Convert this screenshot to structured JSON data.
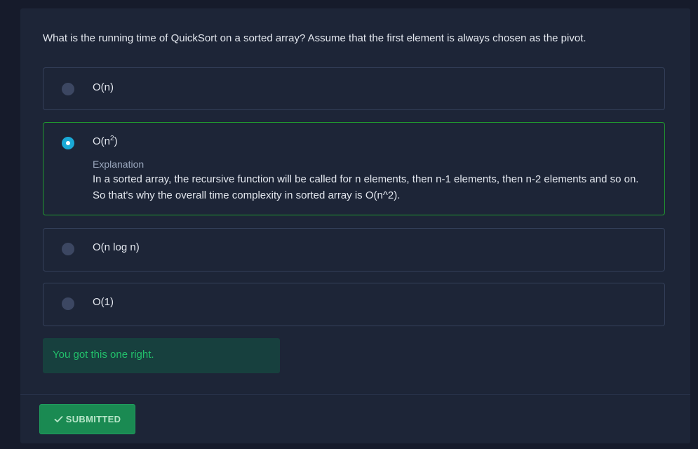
{
  "question": {
    "text": "What is the running time of QuickSort on a sorted array? Assume that the first element is always chosen as the pivot."
  },
  "options": [
    {
      "label": "O(n)",
      "selected": false
    },
    {
      "label_base": "O(n",
      "label_sup": "2",
      "label_tail": ")",
      "selected": true
    },
    {
      "label": "O(n log n)",
      "selected": false
    },
    {
      "label": "O(1)",
      "selected": false
    }
  ],
  "explanation": {
    "title": "Explanation",
    "text": "In a sorted array, the recursive function will be called for n elements, then n-1 elements, then n-2 elements and so on. So that's why the overall time complexity in sorted array is O(n^2)."
  },
  "feedback": {
    "text": "You got this one right."
  },
  "submit": {
    "label": "SUBMITTED",
    "icon": "check-icon"
  },
  "colors": {
    "page_bg": "#161b2b",
    "card_bg": "#1d2537",
    "option_border": "#34405a",
    "selected_border": "#20982f",
    "radio_checked": "#1aa9d6",
    "feedback_bg": "#17403e",
    "feedback_text": "#22c16b",
    "submit_bg": "#1a8a52"
  }
}
